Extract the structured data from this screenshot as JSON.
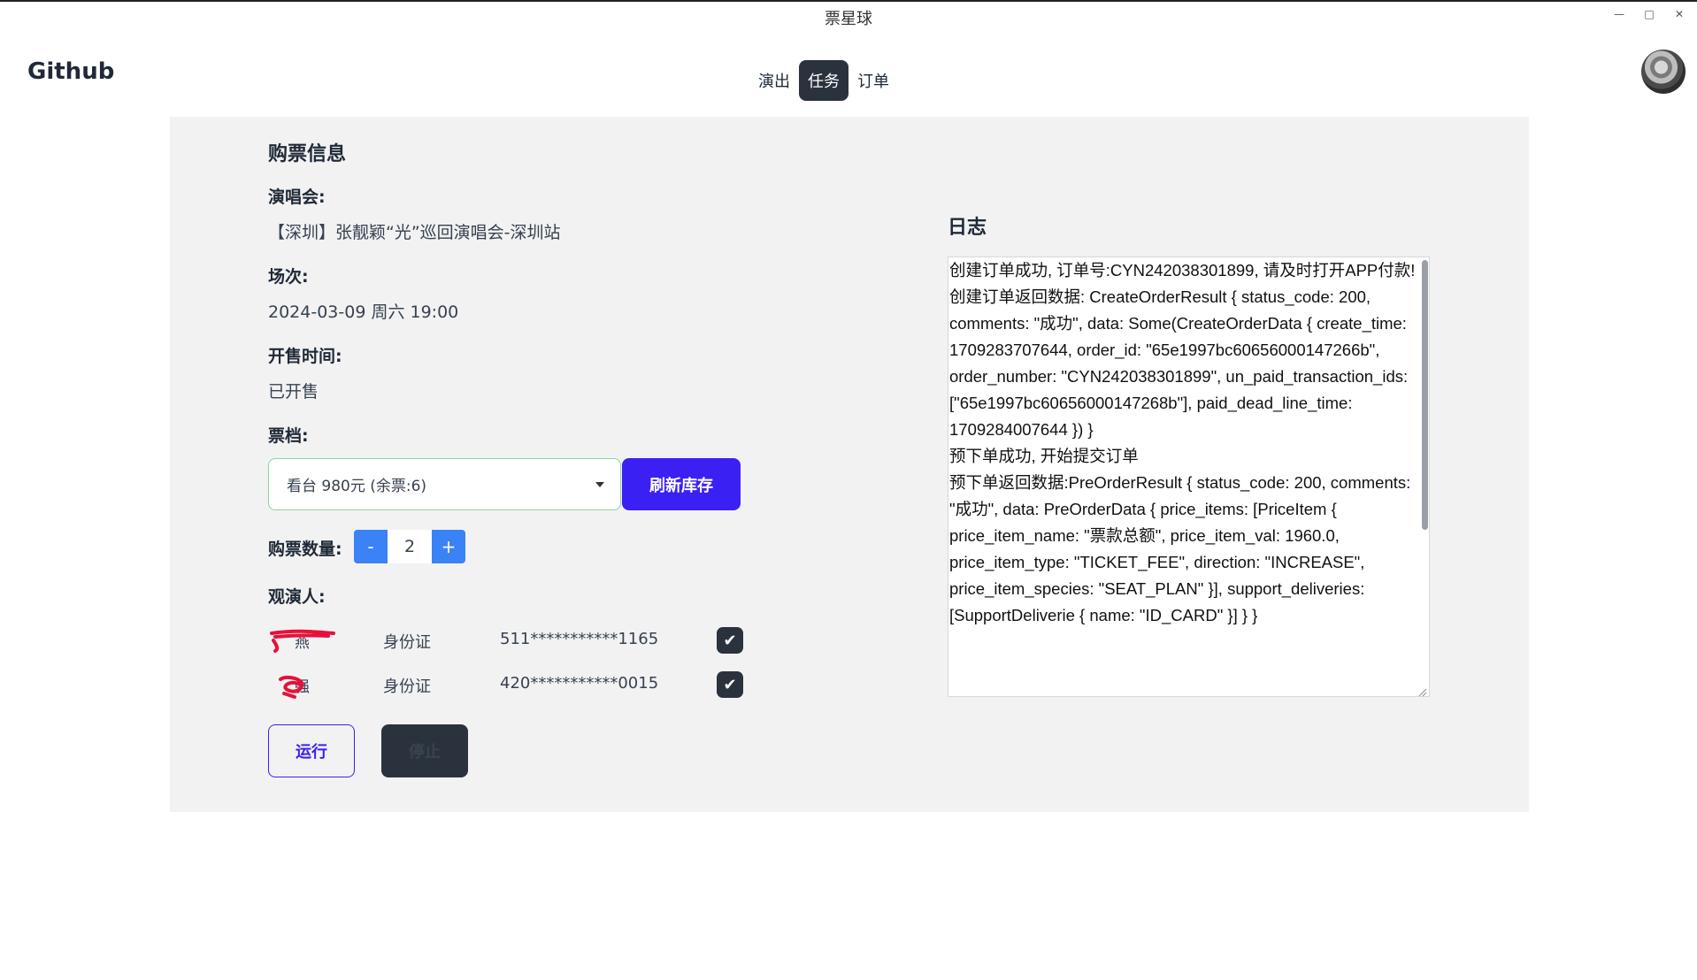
{
  "window": {
    "title": "票星球"
  },
  "header": {
    "brand": "Github",
    "tabs": [
      {
        "label": "演出"
      },
      {
        "label": "任务"
      },
      {
        "label": "订单"
      }
    ]
  },
  "ticket_info": {
    "title": "购票信息",
    "concert_label": "演唱会:",
    "concert_value": "【深圳】张靓颖“光”巡回演唱会-深圳站",
    "session_label": "场次:",
    "session_value": "2024-03-09 周六 19:00",
    "sale_label": "开售时间:",
    "sale_value": "已开售",
    "tier_label": "票档:",
    "tier_selected": "看台 980元 (余票:6)",
    "refresh_label": "刷新库存",
    "qty_label": "购票数量:",
    "qty_minus": "-",
    "qty_value": "2",
    "qty_plus": "+",
    "viewers_label": "观演人:",
    "viewers": [
      {
        "name_tail": "燕",
        "id_type": "身份证",
        "id_number": "511***********1165"
      },
      {
        "name_tail": "强",
        "id_type": "身份证",
        "id_number": "420***********0015"
      }
    ],
    "run_label": "运行",
    "stop_label": "停止"
  },
  "log": {
    "title": "日志",
    "text": "创建订单成功, 订单号:CYN242038301899, 请及时打开APP付款!\n创建订单返回数据: CreateOrderResult { status_code: 200, comments: \"成功\", data: Some(CreateOrderData { create_time: 1709283707644, order_id: \"65e1997bc60656000147266b\", order_number: \"CYN242038301899\", un_paid_transaction_ids: [\"65e1997bc60656000147268b\"], paid_dead_line_time: 1709284007644 }) }\n预下单成功, 开始提交订单\n预下单返回数据:PreOrderResult { status_code: 200, comments: \"成功\", data: PreOrderData { price_items: [PriceItem { price_item_name: \"票款总额\", price_item_val: 1960.0, price_item_type: \"TICKET_FEE\", direction: \"INCREASE\", price_item_species: \"SEAT_PLAN\" }], support_deliveries: [SupportDeliverie { name: \"ID_CARD\" }] } }"
  },
  "colors": {
    "primary": "#3b20f4",
    "dark": "#2a323d",
    "stepper": "#3b82f6",
    "panel_bg": "#f2f2f2",
    "select_border": "#8ad3a6",
    "scribble": "#e8103a"
  }
}
